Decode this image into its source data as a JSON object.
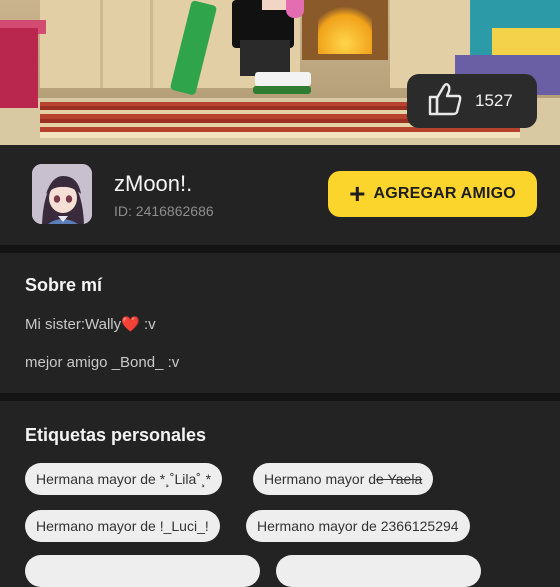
{
  "hero": {
    "likes": "1527",
    "like_icon": "thumbs-up-icon"
  },
  "profile": {
    "username": "zMoon!.",
    "user_id": "ID: 2416862686",
    "add_friend_label": "AGREGAR AMIGO",
    "add_icon": "plus-icon",
    "accent": "#fcd52c"
  },
  "about": {
    "title": "Sobre mí",
    "line1_text": "Mi sister:Wally",
    "line1_emoji": "❤️",
    "line1_suffix": " :v",
    "line2": "mejor amigo _Bond_ :v"
  },
  "tags": {
    "title": "Etiquetas personales",
    "items": [
      {
        "label": "Hermana mayor de *¸˚Lila˚¸*"
      },
      {
        "label_prefix": "Hermano mayor d",
        "label_struck": "e Yaela"
      },
      {
        "label": "Hermano mayor de !_Luci_!"
      },
      {
        "label": "Hermano mayor de 2366125294"
      }
    ]
  }
}
